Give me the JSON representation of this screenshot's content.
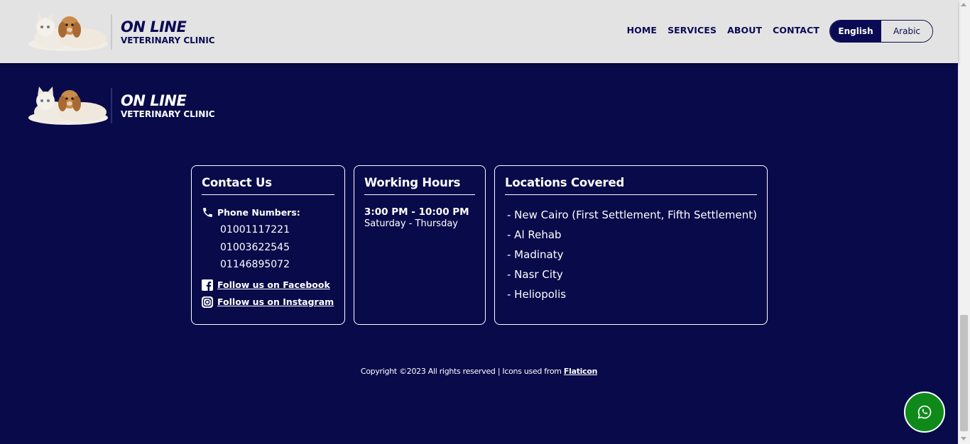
{
  "header": {
    "logo_title": "ON LINE",
    "logo_subtitle": "VETERINARY CLINIC",
    "nav": [
      "HOME",
      "SERVICES",
      "ABOUT",
      "CONTACT"
    ],
    "languages": {
      "active": "English",
      "inactive": "Arabic"
    }
  },
  "footer": {
    "logo_title": "ON LINE",
    "logo_subtitle": "VETERINARY CLINIC",
    "contact": {
      "heading": "Contact Us",
      "phone_label": "Phone Numbers:",
      "phones": [
        "01001117221",
        "01003622545",
        "01146895072"
      ],
      "facebook": "Follow us on Facebook",
      "instagram": "Follow us on Instagram"
    },
    "hours": {
      "heading": "Working Hours",
      "time": "3:00 PM - 10:00 PM",
      "days": "Saturday - Thursday"
    },
    "locations": {
      "heading": "Locations Covered",
      "items": [
        "- New Cairo (First Settlement, Fifth Settlement)",
        "- Al Rehab",
        "- Madinaty",
        "- Nasr City",
        "- Heliopolis"
      ]
    },
    "copyright_text": "Copyright ©2023 All rights reserved | Icons used from ",
    "copyright_link": "Flaticon"
  },
  "colors": {
    "navy": "#080a4a",
    "header_bg": "#e3e3e3",
    "whatsapp_green": "#0f8a1a"
  },
  "icons": [
    "phone-icon",
    "facebook-icon",
    "instagram-icon",
    "whatsapp-icon"
  ]
}
